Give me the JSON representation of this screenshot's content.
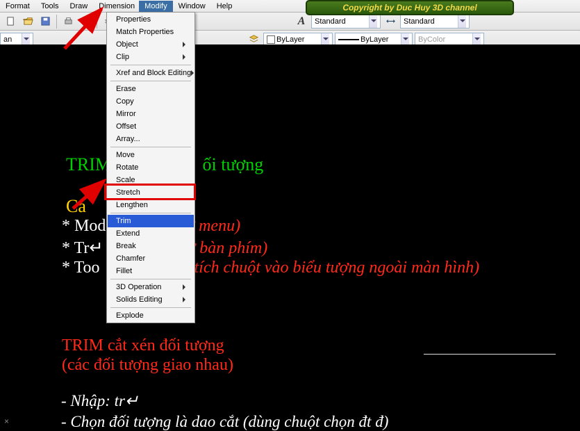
{
  "menubar": {
    "items": [
      "Format",
      "Tools",
      "Draw",
      "Dimension",
      "Modify",
      "Window",
      "Help"
    ],
    "active_index": 4
  },
  "banner": {
    "text": "Copyright by Duc Huy 3D channel"
  },
  "toolbar1": {
    "dim_style": "Standard",
    "text_style": "Standard"
  },
  "toolbar2": {
    "layer": "an",
    "color": "ByLayer",
    "linetype": "ByLayer",
    "lineweight": "ByColor"
  },
  "dropdown": {
    "groups": [
      [
        "Properties",
        "Match Properties",
        {
          "t": "Object",
          "sub": true
        },
        {
          "t": "Clip",
          "sub": true
        }
      ],
      [
        {
          "t": "Xref and Block Editing",
          "sub": true
        }
      ],
      [
        "Erase",
        "Copy",
        "Mirror",
        "Offset",
        "Array..."
      ],
      [
        "Move",
        "Rotate",
        "Scale",
        "Stretch",
        "Lengthen"
      ],
      [
        "Trim",
        "Extend",
        "Break",
        "Chamfer",
        "Fillet"
      ],
      [
        {
          "t": "3D Operation",
          "sub": true
        },
        {
          "t": "Solids Editing",
          "sub": true
        }
      ],
      [
        "Explode"
      ]
    ],
    "highlight": "Trim"
  },
  "canvas": {
    "title_green": "TRIM cắt xén đối tượng",
    "line_yellow": "Cách gọi lệnh",
    "rows": [
      {
        "white": "* Modify ",
        "red": "(từ menu)"
      },
      {
        "white": "* Tr↵ ",
        "red": "(từ bàn phím)"
      },
      {
        "white": "* Toolbars\\Modify ",
        "red": "(tích chuột vào biểu tượng ngoài màn hình)"
      }
    ],
    "section2_title": "TRIM cắt xén đối tượng",
    "section2_sub": "(các đối tượng giao nhau)",
    "steps": [
      "- Nhập: tr↵",
      "- Chọn đối tượng là dao cắt (dùng chuột chọn đt đ)"
    ]
  }
}
